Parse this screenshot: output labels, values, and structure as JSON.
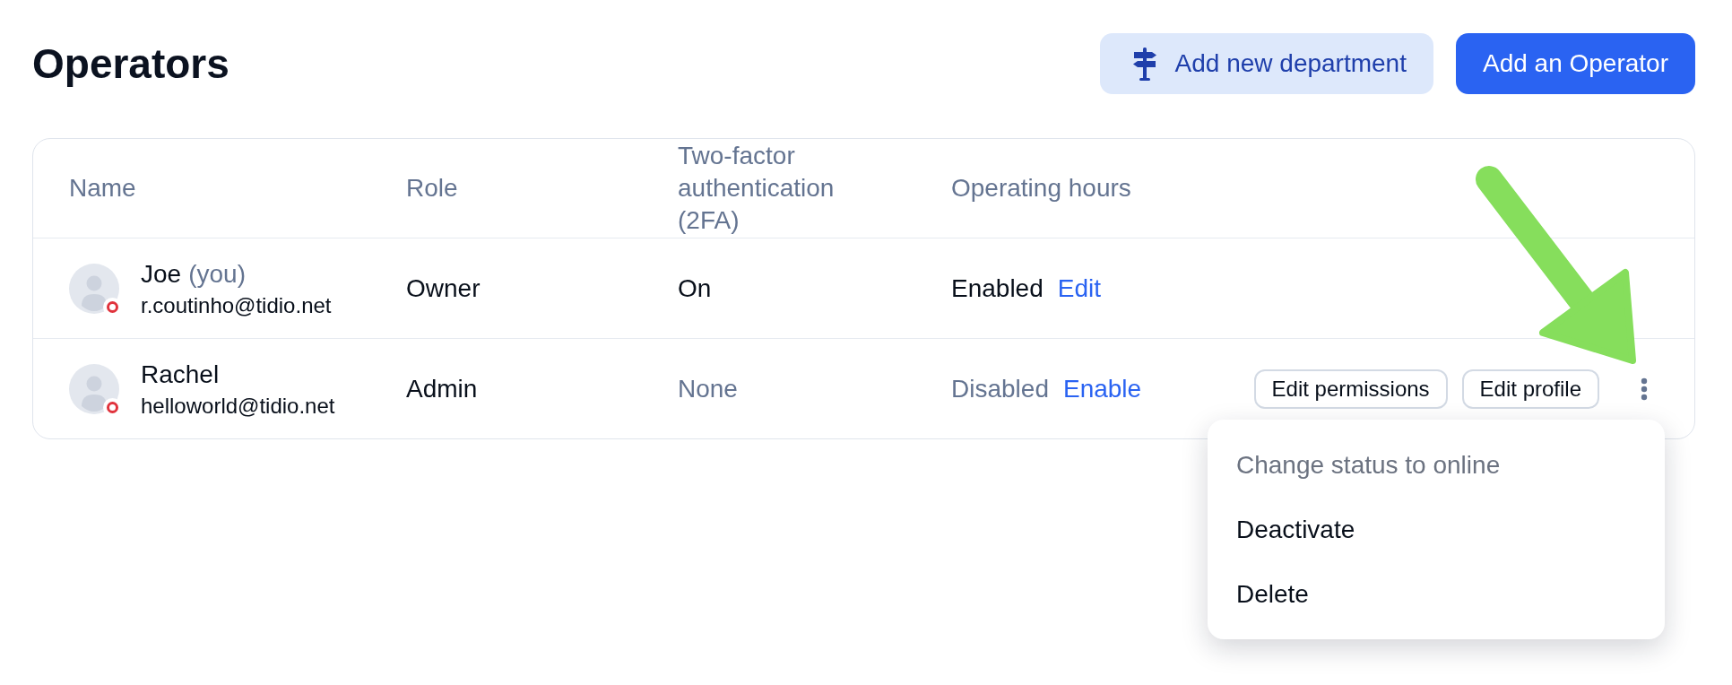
{
  "page": {
    "title": "Operators"
  },
  "header_buttons": [
    {
      "label": "Add new department",
      "kind": "secondary"
    },
    {
      "label": "Add an Operator",
      "kind": "primary"
    }
  ],
  "table": {
    "columns": [
      "Name",
      "Role",
      "Two-factor authentication (2FA)",
      "Operating hours"
    ],
    "rows": [
      {
        "name": "Joe",
        "you_label": "(you)",
        "email": "r.coutinho@tidio.net",
        "online": false,
        "role": "Owner",
        "two_fa": {
          "text": "On",
          "enabled": true
        },
        "operating_hours": {
          "text": "Enabled",
          "enabled": true,
          "link": "Edit"
        }
      },
      {
        "name": "Rachel",
        "email": "helloworld@tidio.net",
        "online": false,
        "role": "Admin",
        "two_fa": {
          "text": "None",
          "enabled": false
        },
        "operating_hours": {
          "text": "Disabled",
          "enabled": false,
          "link": "Enable"
        },
        "actions": [
          "Edit permissions",
          "Edit profile"
        ]
      }
    ]
  },
  "row_menu": {
    "items": [
      {
        "label": "Change status to online",
        "disabled": true
      },
      {
        "label": "Deactivate",
        "disabled": false
      },
      {
        "label": "Delete",
        "disabled": false
      }
    ]
  }
}
